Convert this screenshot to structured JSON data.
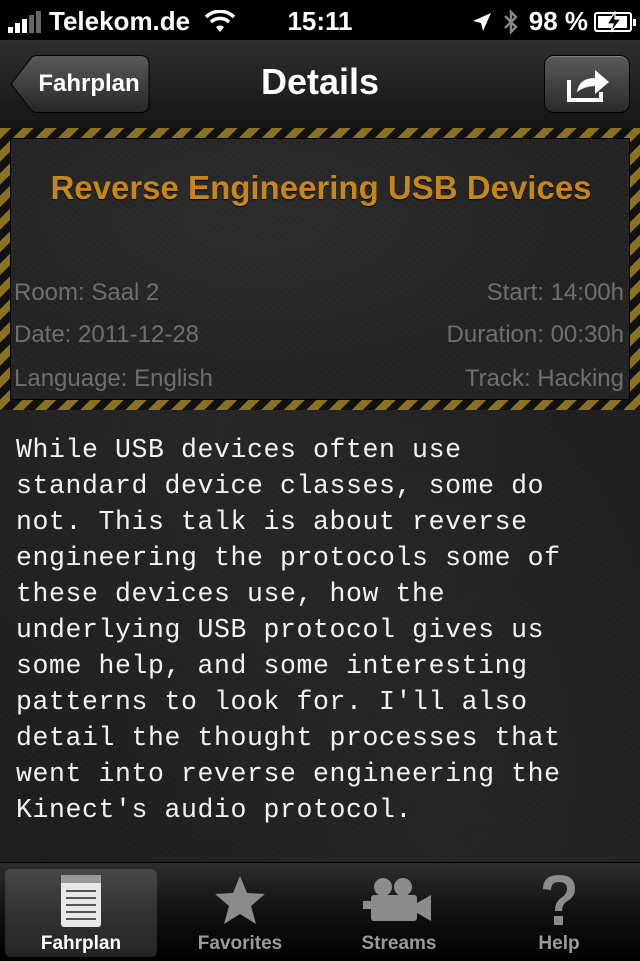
{
  "status_bar": {
    "carrier": "Telekom.de",
    "time": "15:11",
    "battery": "98 %",
    "battery_level": 0.98
  },
  "nav": {
    "back_label": "Fahrplan",
    "title": "Details"
  },
  "talk": {
    "title": "Reverse Engineering USB Devices",
    "room": "Room: Saal 2",
    "date": "Date: 2011-12-28",
    "language": "Language: English",
    "start": "Start: 14:00h",
    "duration": "Duration: 00:30h",
    "track": "Track: Hacking",
    "title_color": "#c5861c",
    "description_lines": [
      "While USB devices often use",
      "standard device classes, some do",
      "not. This talk is about reverse",
      "engineering the protocols some of",
      "these devices use, how the",
      "underlying USB protocol gives us",
      "some help, and some interesting",
      "patterns to look for. I'll also",
      "detail the thought processes that",
      "went into reverse engineering the",
      "Kinect's audio protocol."
    ]
  },
  "tabs": [
    {
      "label": "Fahrplan",
      "icon": "notepad-icon",
      "active": true
    },
    {
      "label": "Favorites",
      "icon": "star-icon",
      "active": false
    },
    {
      "label": "Streams",
      "icon": "video-camera-icon",
      "active": false
    },
    {
      "label": "Help",
      "icon": "question-mark-icon",
      "active": false
    }
  ]
}
